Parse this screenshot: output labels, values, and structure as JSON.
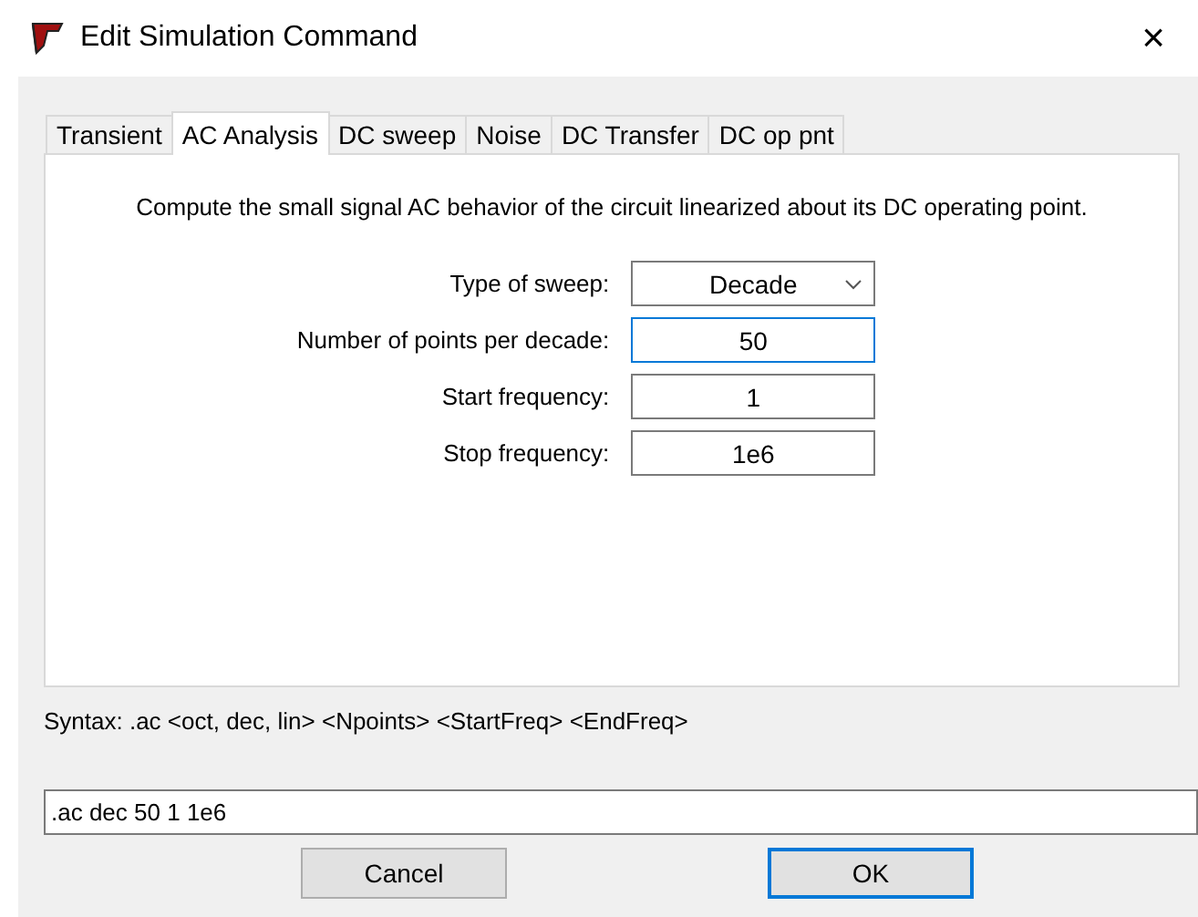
{
  "window": {
    "title": "Edit Simulation Command",
    "close": "×"
  },
  "tabs": [
    {
      "label": "Transient",
      "selected": false
    },
    {
      "label": "AC Analysis",
      "selected": true
    },
    {
      "label": "DC sweep",
      "selected": false
    },
    {
      "label": "Noise",
      "selected": false
    },
    {
      "label": "DC Transfer",
      "selected": false
    },
    {
      "label": "DC op pnt",
      "selected": false
    }
  ],
  "description": "Compute the small signal AC behavior of the circuit linearized about its DC operating point.",
  "fields": [
    {
      "kind": "dropdown",
      "label": "Type of sweep:",
      "value": "Decade",
      "focused": false
    },
    {
      "kind": "text",
      "label": "Number of points per decade:",
      "value": "50",
      "focused": true
    },
    {
      "kind": "text",
      "label": "Start frequency:",
      "value": "1",
      "focused": false
    },
    {
      "kind": "text",
      "label": "Stop frequency:",
      "value": "1e6",
      "focused": false
    }
  ],
  "syntax": "Syntax:  .ac <oct, dec, lin> <Npoints> <StartFreq> <EndFreq>",
  "command": ".ac dec 50 1 1e6",
  "buttons": [
    {
      "label": "Cancel",
      "default": false
    },
    {
      "label": "OK",
      "default": true
    }
  ]
}
